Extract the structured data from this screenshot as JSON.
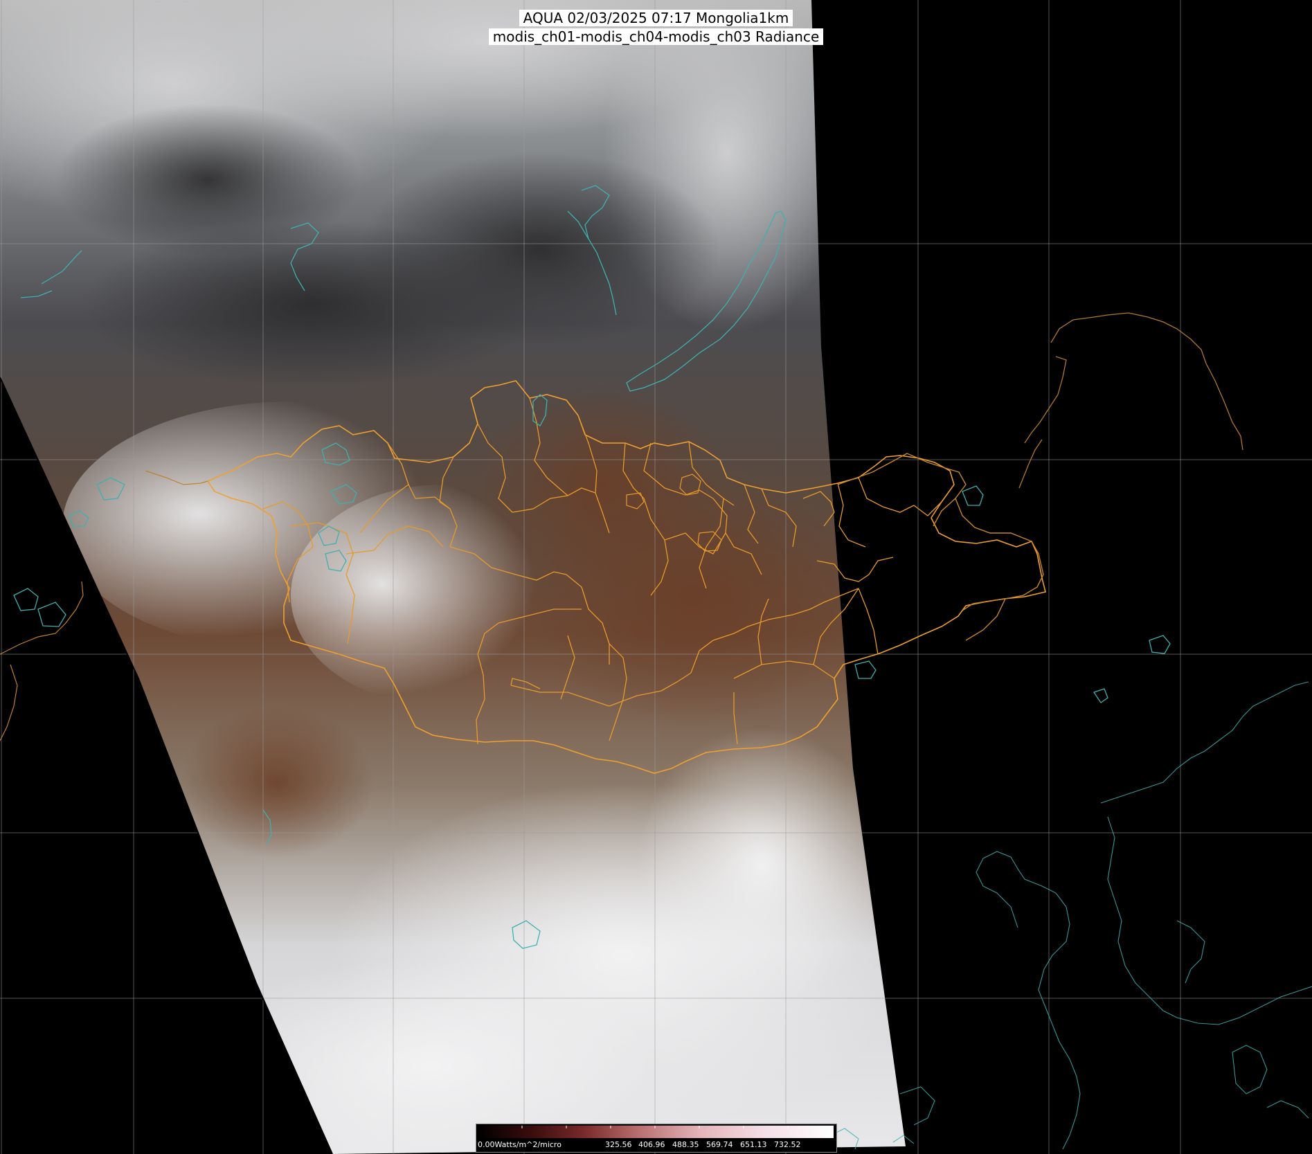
{
  "title": {
    "line1": "AQUA 02/03/2025 07:17 Mongolia1km",
    "line2": "modis_ch01-modis_ch04-modis_ch03 Radiance"
  },
  "colorbar": {
    "unit_label": "0.00Watts/m^2/micro",
    "ticks": [
      "325.56",
      "406.96",
      "488.35",
      "569.74",
      "651.13",
      "732.52"
    ],
    "colors": [
      "#000000",
      "#3a0c0c",
      "#7a2a2a",
      "#b86e6e",
      "#e3b3b8",
      "#f4dde6",
      "#ffffff"
    ]
  },
  "colors": {
    "country_border": "#f0a030",
    "province_border": "#e89a2a",
    "coastline": "#3fb0b0",
    "graticule": "#9a9a9a",
    "background": "#000000"
  }
}
